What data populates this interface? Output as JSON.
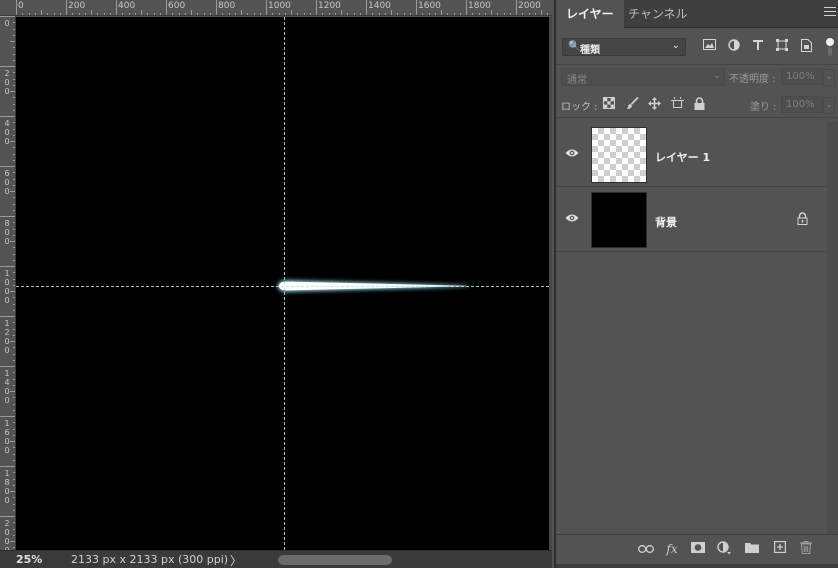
{
  "ruler": {
    "top_labels": [
      "0",
      "200",
      "400",
      "600",
      "800",
      "1000",
      "1200",
      "1400",
      "1600",
      "1800",
      "2000"
    ],
    "left_labels": [
      "0",
      "2\n0\n0",
      "4\n0\n0",
      "6\n0\n0",
      "8\n0\n0",
      "1\n0\n0\n0",
      "1\n2\n0\n0",
      "1\n4\n0\n0",
      "1\n6\n0\n0",
      "1\n8\n0\n0",
      "2\n0\n0\n0"
    ]
  },
  "status": {
    "zoom": "25%",
    "doc_info": "2133 px x 2133 px (300 ppi)",
    "chevron": "〉"
  },
  "panel": {
    "tabs": [
      {
        "label": "レイヤー",
        "active": true
      },
      {
        "label": "チャンネル",
        "active": false
      }
    ],
    "filter": {
      "search_icon": "🔍",
      "label": "種類",
      "chevron": "⌄",
      "icons": [
        "image-filter-icon",
        "adjustment-filter-icon",
        "type-filter-icon",
        "shape-filter-icon",
        "smart-object-filter-icon"
      ]
    },
    "blend_mode": "通常",
    "opacity_label": "不透明度 :",
    "opacity_value": "100%",
    "lock_label": "ロック :",
    "fill_label": "塗り :",
    "fill_value": "100%",
    "layers": [
      {
        "name": "レイヤー 1",
        "thumbnail": "transparent",
        "visible": true,
        "locked": false
      },
      {
        "name": "背景",
        "thumbnail": "black",
        "visible": true,
        "locked": true
      }
    ],
    "footer_icons": [
      "link-icon",
      "fx-icon",
      "mask-icon",
      "adjustment-icon",
      "folder-icon",
      "new-layer-icon",
      "trash-icon"
    ],
    "fx_text": "fx"
  },
  "colors": {
    "ui_bg": "#535353",
    "canvas": "#000000",
    "guide": "#bfe3e8",
    "stroke_glow": "#9fe3f0"
  }
}
